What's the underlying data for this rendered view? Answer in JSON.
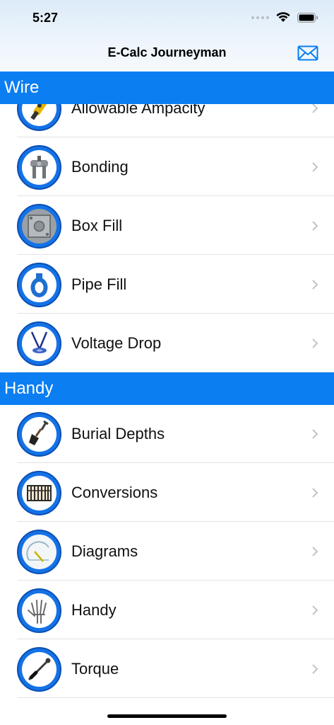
{
  "status": {
    "time": "5:27"
  },
  "nav": {
    "title": "E-Calc Journeyman"
  },
  "sections": {
    "wire": {
      "title": "Wire",
      "items": [
        {
          "label": "Allowable Ampacity",
          "icon": "ampacity-icon"
        },
        {
          "label": "Bonding",
          "icon": "bonding-clamp-icon"
        },
        {
          "label": "Box Fill",
          "icon": "junction-box-icon"
        },
        {
          "label": "Pipe Fill",
          "icon": "pipe-fitting-icon"
        },
        {
          "label": "Voltage Drop",
          "icon": "voltage-drop-icon"
        }
      ]
    },
    "handy": {
      "title": "Handy",
      "items": [
        {
          "label": "Burial Depths",
          "icon": "shovel-icon"
        },
        {
          "label": "Conversions",
          "icon": "abacus-icon"
        },
        {
          "label": "Diagrams",
          "icon": "protractor-icon"
        },
        {
          "label": "Handy",
          "icon": "hand-xray-icon"
        },
        {
          "label": "Torque",
          "icon": "torque-wrench-icon"
        }
      ]
    }
  },
  "colors": {
    "accent": "#0b7ef2",
    "icon_ring": "#1472e6"
  }
}
